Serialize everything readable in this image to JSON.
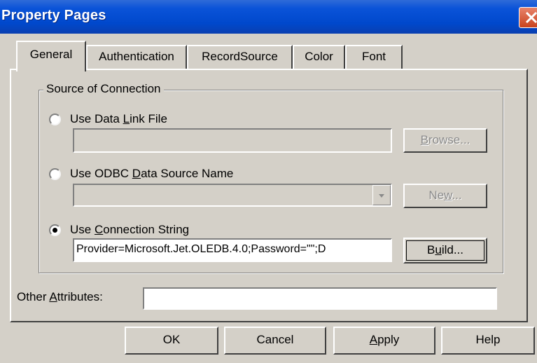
{
  "window": {
    "title": "Property Pages"
  },
  "tabs": [
    {
      "label": "General",
      "active": true
    },
    {
      "label": "Authentication",
      "active": false
    },
    {
      "label": "RecordSource",
      "active": false
    },
    {
      "label": "Color",
      "active": false
    },
    {
      "label": "Font",
      "active": false
    }
  ],
  "source_group": {
    "legend": "Source of Connection",
    "data_link": {
      "pre": "Use Data ",
      "key": "L",
      "post": "ink File",
      "selected": false,
      "value": "",
      "browse_pre": "",
      "browse_key": "B",
      "browse_post": "rowse..."
    },
    "odbc": {
      "pre": "Use ODBC ",
      "key": "D",
      "post": "ata Source Name",
      "selected": false,
      "value": "",
      "new_pre": "Ne",
      "new_key": "w",
      "new_post": "..."
    },
    "conn_string": {
      "pre": "Use ",
      "key": "C",
      "post": "onnection String",
      "selected": true,
      "value": "Provider=Microsoft.Jet.OLEDB.4.0;Password=\"\";D",
      "build_pre": "B",
      "build_key": "u",
      "build_post": "ild..."
    }
  },
  "other_attributes": {
    "pre": "Other ",
    "key": "A",
    "post": "ttributes:",
    "value": ""
  },
  "buttons": {
    "ok": "OK",
    "cancel": "Cancel",
    "apply_key": "A",
    "apply_post": "pply",
    "help": "Help"
  },
  "colors": {
    "titlebar": "#0a53d8",
    "face": "#d4d0c8",
    "close": "#c8431e"
  },
  "icons": {
    "close": "close-x-icon",
    "dropdown": "chevron-down-icon"
  }
}
